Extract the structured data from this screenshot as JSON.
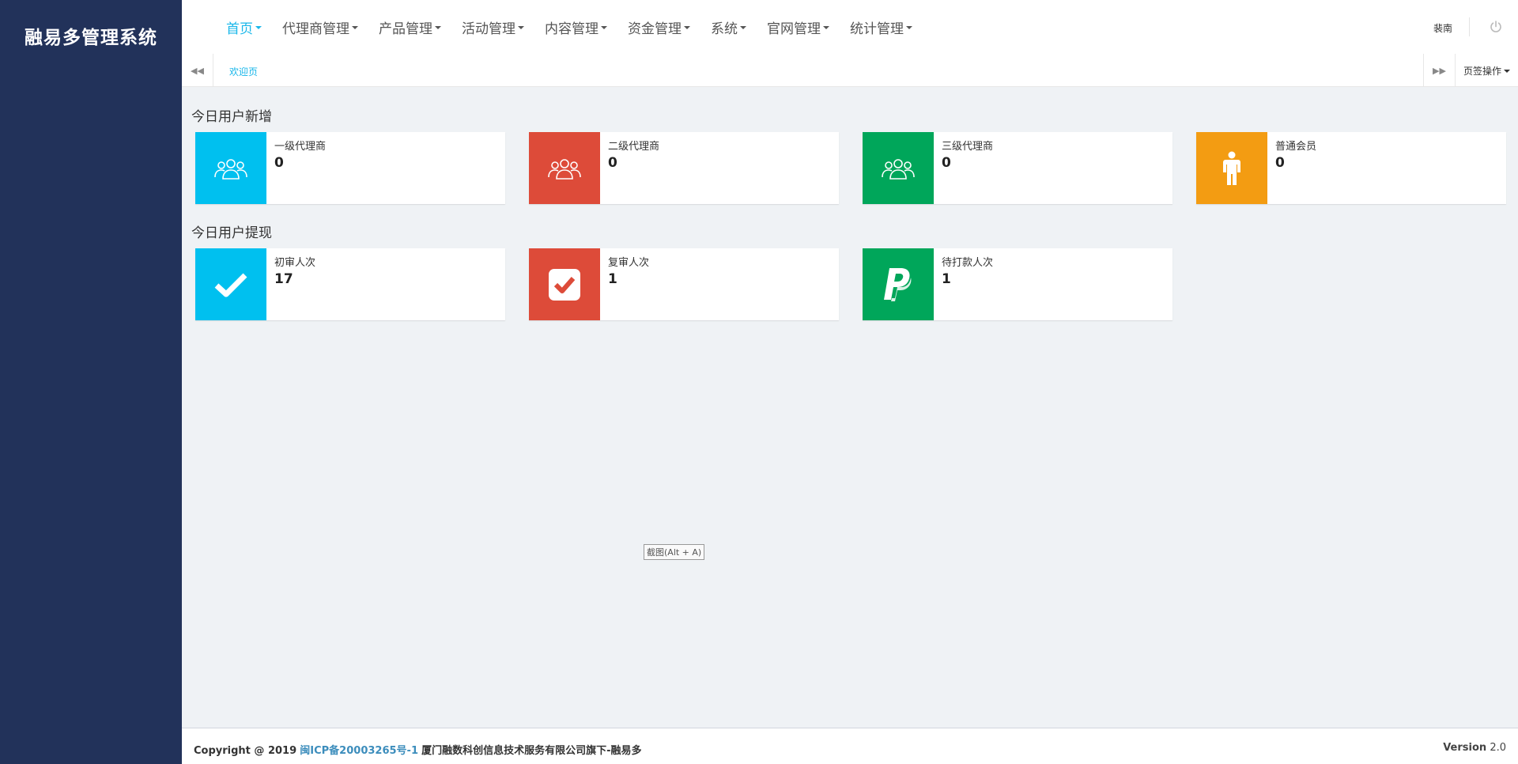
{
  "sidebar": {
    "logo": "融易多管理系统"
  },
  "nav": {
    "items": [
      {
        "label": "首页"
      },
      {
        "label": "代理商管理"
      },
      {
        "label": "产品管理"
      },
      {
        "label": "活动管理"
      },
      {
        "label": "内容管理"
      },
      {
        "label": "资金管理"
      },
      {
        "label": "系统"
      },
      {
        "label": "官网管理"
      },
      {
        "label": "统计管理"
      }
    ],
    "user": "裴南",
    "accent_color": "#1ab7ea"
  },
  "tabs": {
    "welcome": "欢迎页",
    "ops": "页签操作"
  },
  "sections": {
    "new_users": {
      "title": "今日用户新增",
      "cards": [
        {
          "label": "一级代理商",
          "value": "0",
          "color": "#00c0ef",
          "icon": "users-icon"
        },
        {
          "label": "二级代理商",
          "value": "0",
          "color": "#dd4b39",
          "icon": "users-icon"
        },
        {
          "label": "三级代理商",
          "value": "0",
          "color": "#00a65a",
          "icon": "users-icon"
        },
        {
          "label": "普通会员",
          "value": "0",
          "color": "#f39c12",
          "icon": "person-icon"
        }
      ]
    },
    "withdraw": {
      "title": "今日用户提现",
      "cards": [
        {
          "label": "初审人次",
          "value": "17",
          "color": "#00c0ef",
          "icon": "check-icon"
        },
        {
          "label": "复审人次",
          "value": "1",
          "color": "#dd4b39",
          "icon": "check-square-icon"
        },
        {
          "label": "待打款人次",
          "value": "1",
          "color": "#00a65a",
          "icon": "paypal-icon"
        }
      ]
    }
  },
  "screenshot_tip": "截图(Alt + A)",
  "footer": {
    "copyright": "Copyright @ 2019",
    "icp": "闽ICP备20003265号-1",
    "company": "厦门融数科创信息技术服务有限公司旗下-融易多",
    "version_label": "Version",
    "version": "2.0"
  }
}
